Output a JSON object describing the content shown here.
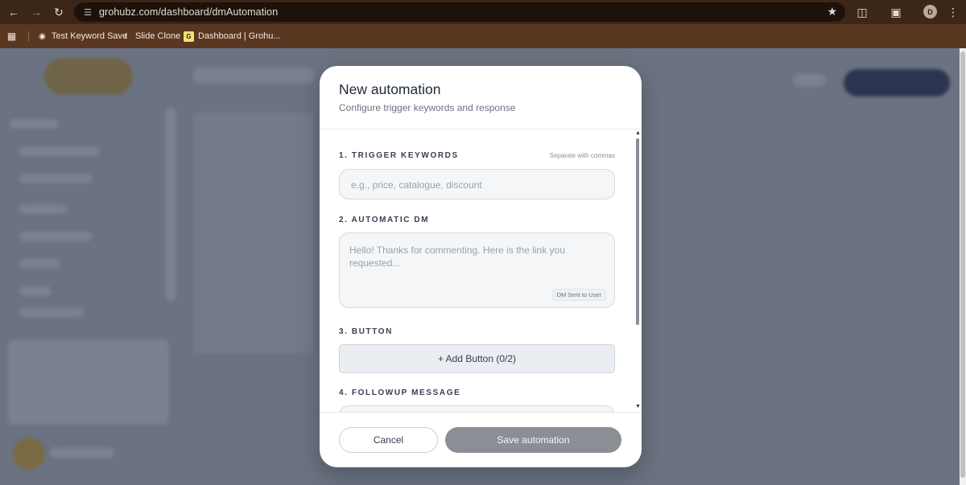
{
  "browser": {
    "url": "grohubz.com/dashboard/dmAutomation",
    "profile_initial": "D",
    "bookmarks": [
      {
        "label": "Test Keyword Save",
        "icon": "globe-icon"
      },
      {
        "label": "Slide Clone",
        "icon": "bookmark-icon"
      },
      {
        "label": "Dashboard | Grohu...",
        "icon": "site-favicon-icon"
      }
    ]
  },
  "modal": {
    "title": "New automation",
    "subtitle": "Configure trigger keywords and response",
    "sections": {
      "trigger": {
        "label": "1. TRIGGER KEYWORDS",
        "hint": "Separate with commas",
        "placeholder": "e.g., price, catalogue, discount"
      },
      "dm": {
        "label": "2. AUTOMATIC DM",
        "placeholder": "Hello! Thanks for commenting. Here is the link you requested...",
        "tag": "DM Sent to User"
      },
      "button": {
        "label": "3. BUTTON",
        "add_label": "+ Add Button (0/2)"
      },
      "followup": {
        "label": "4. FOLLOWUP MESSAGE"
      }
    },
    "footer": {
      "cancel_label": "Cancel",
      "save_label": "Save automation"
    }
  },
  "colors": {
    "overlay": "#6b7382",
    "save_button_disabled": "#8b8f95",
    "browser_toolbar": "#3c2618",
    "bookmarks_bar": "#5a3720"
  }
}
